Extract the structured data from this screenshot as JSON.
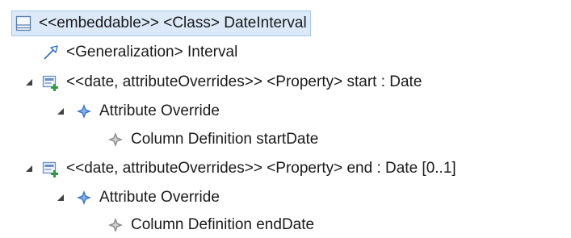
{
  "tree": {
    "nodes": [
      {
        "label": "<<embeddable>> <Class> DateInterval",
        "icon": "class-icon",
        "expanded": true,
        "selected": true
      },
      {
        "label": "<Generalization> Interval",
        "icon": "generalization-icon"
      },
      {
        "label": "<<date, attributeOverrides>> <Property> start : Date",
        "icon": "property-icon",
        "expanded": true
      },
      {
        "label": "Attribute Override",
        "icon": "stereotype-application-icon",
        "expanded": true
      },
      {
        "label": "Column Definition startDate",
        "icon": "stereotype-property-icon"
      },
      {
        "label": "<<date, attributeOverrides>> <Property> end : Date [0..1]",
        "icon": "property-icon",
        "expanded": true
      },
      {
        "label": "Attribute Override",
        "icon": "stereotype-application-icon",
        "expanded": true
      },
      {
        "label": "Column Definition endDate",
        "icon": "stereotype-property-icon"
      }
    ]
  },
  "colors": {
    "selection_bg": "#dbe9f8",
    "selection_border": "#a8c8ee",
    "text": "#1a1a1a",
    "expander": "#404040",
    "property_icon_blue": "#6a8fc4",
    "property_icon_green": "#2e9b3e",
    "diamond_blue": "#3c78c8",
    "diamond_gray": "#8a8a8a"
  }
}
